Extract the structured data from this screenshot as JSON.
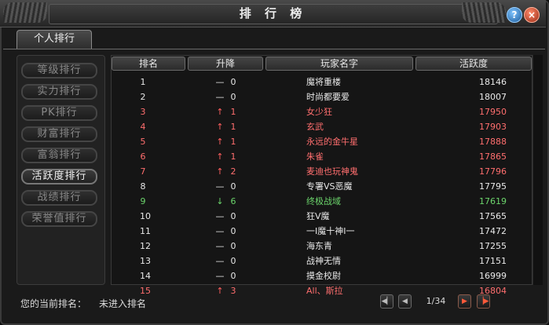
{
  "window": {
    "title": "排 行 榜"
  },
  "titlebar": {
    "help_icon": "?",
    "close_icon": "×"
  },
  "tabs": [
    {
      "label": "个人排行"
    }
  ],
  "categories": [
    {
      "label": "等级排行"
    },
    {
      "label": "实力排行"
    },
    {
      "label": "PK排行"
    },
    {
      "label": "财富排行"
    },
    {
      "label": "富翁排行"
    },
    {
      "label": "活跃度排行",
      "active": true
    },
    {
      "label": "战绩排行"
    },
    {
      "label": "荣誉值排行"
    }
  ],
  "table": {
    "headers": [
      "排名",
      "升降",
      "玩家名字",
      "活跃度"
    ],
    "rows": [
      {
        "rank": "1",
        "arrow": "—",
        "change": "0",
        "name": "魔将重楼",
        "activity": "18146",
        "color": "white"
      },
      {
        "rank": "2",
        "arrow": "—",
        "change": "0",
        "name": "时尚都要爱",
        "activity": "18007",
        "color": "white"
      },
      {
        "rank": "3",
        "arrow": "↑",
        "change": "1",
        "name": "女少狂",
        "activity": "17950",
        "color": "red"
      },
      {
        "rank": "4",
        "arrow": "↑",
        "change": "1",
        "name": "玄武",
        "activity": "17903",
        "color": "red"
      },
      {
        "rank": "5",
        "arrow": "↑",
        "change": "1",
        "name": "永远的金牛星",
        "activity": "17888",
        "color": "red"
      },
      {
        "rank": "6",
        "arrow": "↑",
        "change": "1",
        "name": "朱雀",
        "activity": "17865",
        "color": "red"
      },
      {
        "rank": "7",
        "arrow": "↑",
        "change": "2",
        "name": "麦迪也玩神鬼",
        "activity": "17796",
        "color": "red"
      },
      {
        "rank": "8",
        "arrow": "—",
        "change": "0",
        "name": "专署VS恶魔",
        "activity": "17795",
        "color": "white"
      },
      {
        "rank": "9",
        "arrow": "↓",
        "change": "6",
        "name": "终极战域",
        "activity": "17619",
        "color": "green"
      },
      {
        "rank": "10",
        "arrow": "—",
        "change": "0",
        "name": "狂V魔",
        "activity": "17565",
        "color": "white"
      },
      {
        "rank": "11",
        "arrow": "—",
        "change": "0",
        "name": "一I魔十神I一",
        "activity": "17472",
        "color": "white"
      },
      {
        "rank": "12",
        "arrow": "—",
        "change": "0",
        "name": "海东青",
        "activity": "17255",
        "color": "white"
      },
      {
        "rank": "13",
        "arrow": "—",
        "change": "0",
        "name": "战神无情",
        "activity": "17151",
        "color": "white"
      },
      {
        "rank": "14",
        "arrow": "—",
        "change": "0",
        "name": "摸金校尉",
        "activity": "16999",
        "color": "white"
      },
      {
        "rank": "15",
        "arrow": "↑",
        "change": "3",
        "name": "All、斯拉",
        "activity": "16804",
        "color": "red"
      }
    ]
  },
  "footer": {
    "my_rank_label": "您的当前排名：",
    "my_rank_value": "未进入排名",
    "page_info": "1/34",
    "first_icon": "first-page-icon",
    "prev_icon": "prev-page-icon",
    "next_icon": "next-page-icon",
    "last_icon": "last-page-icon"
  },
  "colors": {
    "rise": "#ff6e6e",
    "fall": "#6cd56c",
    "normal": "#e8e8e8"
  }
}
